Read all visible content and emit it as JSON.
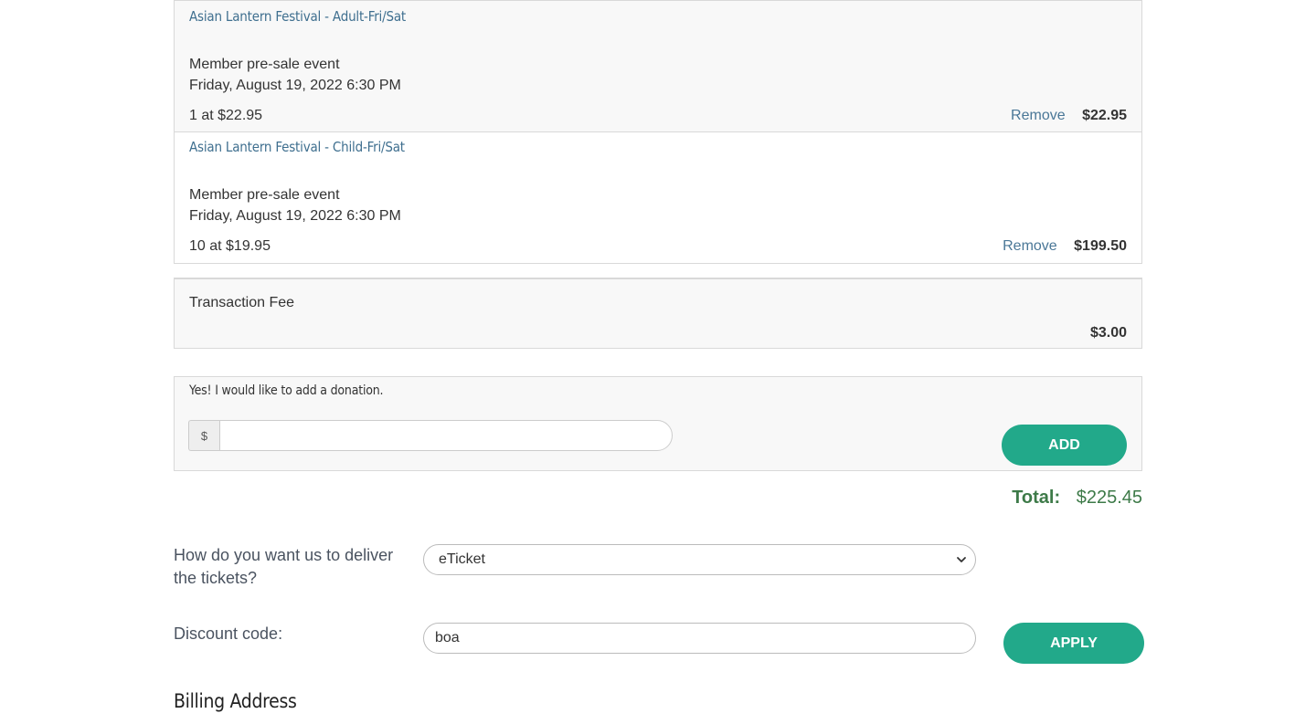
{
  "cart": {
    "items": [
      {
        "title": "Asian Lantern Festival - Adult-Fri/Sat",
        "event_type": "Member pre-sale event",
        "datetime": "Friday, August 19, 2022 6:30 PM",
        "quantity_text": "1 at $22.95",
        "remove_label": "Remove",
        "price": "$22.95"
      },
      {
        "title": "Asian Lantern Festival - Child-Fri/Sat",
        "event_type": "Member pre-sale event",
        "datetime": "Friday, August 19, 2022 6:30 PM",
        "quantity_text": "10 at $19.95",
        "remove_label": "Remove",
        "price": "$199.50"
      }
    ],
    "fee": {
      "label": "Transaction Fee",
      "amount": "$3.00"
    }
  },
  "donation": {
    "title": "Yes! I would like to add a donation.",
    "currency_symbol": "$",
    "value": "",
    "add_label": "ADD"
  },
  "total": {
    "label": "Total:",
    "amount": "$225.45"
  },
  "delivery": {
    "label": "How do you want us to deliver the tickets?",
    "selected": "eTicket"
  },
  "discount": {
    "label": "Discount code:",
    "value": "boa",
    "apply_label": "APPLY"
  },
  "billing": {
    "title": "Billing Address"
  },
  "colors": {
    "accent_green": "#22a98a",
    "total_green": "#3d7a48",
    "link_blue": "#4a7797"
  }
}
